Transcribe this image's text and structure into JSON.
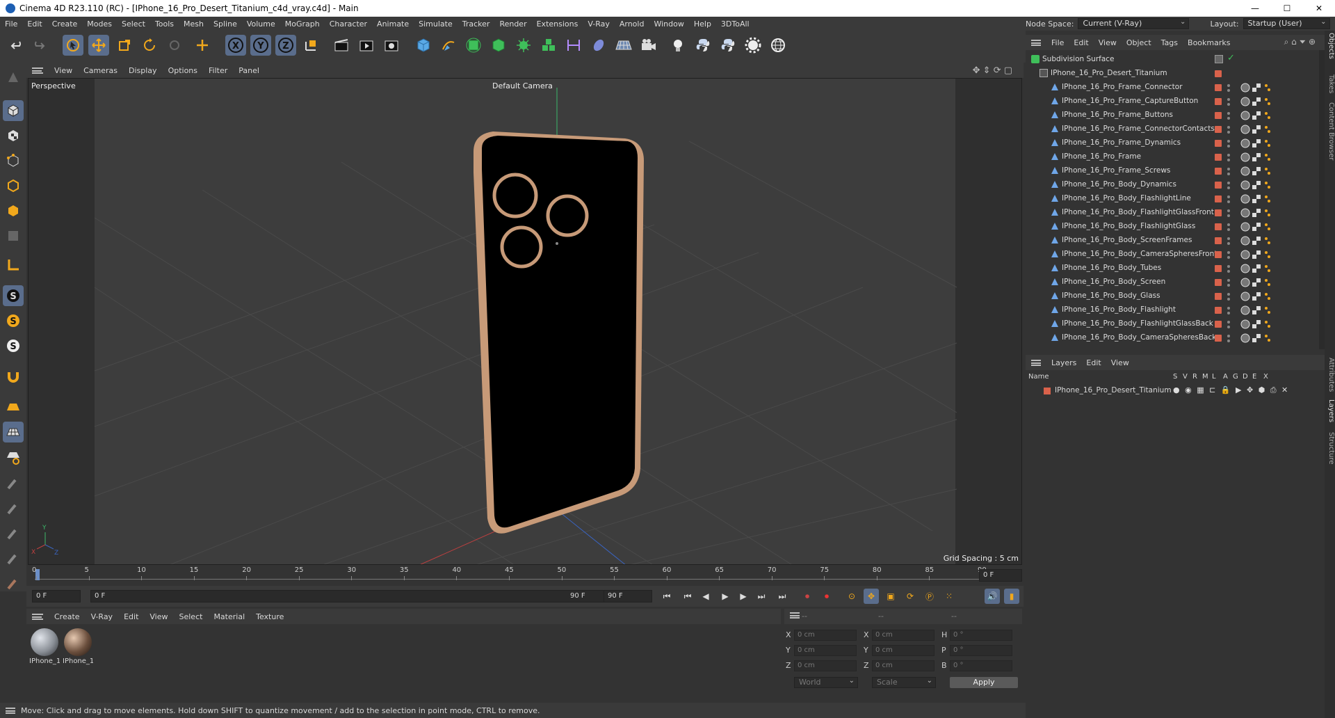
{
  "window": {
    "title": "Cinema 4D R23.110 (RC) - [IPhone_16_Pro_Desert_Titanium_c4d_vray.c4d] - Main",
    "minimize": "—",
    "maximize": "☐",
    "close": "✕"
  },
  "menubar": [
    "File",
    "Edit",
    "Create",
    "Modes",
    "Select",
    "Tools",
    "Mesh",
    "Spline",
    "Volume",
    "MoGraph",
    "Character",
    "Animate",
    "Simulate",
    "Tracker",
    "Render",
    "Extensions",
    "V-Ray",
    "Arnold",
    "Window",
    "Help",
    "3DToAll"
  ],
  "nodespace": {
    "label": "Node Space:",
    "value": "Current (V-Ray)",
    "layout_label": "Layout:",
    "layout_value": "Startup (User)"
  },
  "viewport": {
    "menu": [
      "View",
      "Cameras",
      "Display",
      "Options",
      "Filter",
      "Panel"
    ],
    "view_name": "Perspective",
    "camera_name": "Default Camera",
    "grid_spacing": "Grid Spacing : 5 cm"
  },
  "timeline": {
    "ticks": [
      "0",
      "5",
      "10",
      "15",
      "20",
      "25",
      "30",
      "35",
      "40",
      "45",
      "50",
      "55",
      "60",
      "65",
      "70",
      "75",
      "80",
      "85",
      "90"
    ],
    "end_frame_field": "0 F",
    "current_start": "0 F",
    "range_start": "0 F",
    "range_end": "90 F",
    "max_field": "90 F"
  },
  "materials": {
    "menu": [
      "Create",
      "V-Ray",
      "Edit",
      "View",
      "Select",
      "Material",
      "Texture"
    ],
    "items": [
      {
        "label": "IPhone_1",
        "color": "#8a8f96"
      },
      {
        "label": "IPhone_1",
        "color": "#6b4f3d"
      }
    ]
  },
  "coords": {
    "header": [
      "--",
      "--",
      "--"
    ],
    "rows": [
      {
        "l1": "X",
        "v1": "0 cm",
        "l2": "X",
        "v2": "0 cm",
        "l3": "H",
        "v3": "0 °"
      },
      {
        "l1": "Y",
        "v1": "0 cm",
        "l2": "Y",
        "v2": "0 cm",
        "l3": "P",
        "v3": "0 °"
      },
      {
        "l1": "Z",
        "v1": "0 cm",
        "l2": "Z",
        "v2": "0 cm",
        "l3": "B",
        "v3": "0 °"
      }
    ],
    "mode": "World",
    "scale": "Scale",
    "apply": "Apply"
  },
  "status": "Move: Click and drag to move elements. Hold down SHIFT to quantize movement / add to the selection in point mode, CTRL to remove.",
  "objects": {
    "menu": [
      "File",
      "Edit",
      "View",
      "Object",
      "Tags",
      "Bookmarks"
    ],
    "root": "Subdivision Surface",
    "group": "IPhone_16_Pro_Desert_Titanium",
    "items": [
      "IPhone_16_Pro_Frame_Connector",
      "IPhone_16_Pro_Frame_CaptureButton",
      "IPhone_16_Pro_Frame_Buttons",
      "IPhone_16_Pro_Frame_ConnectorContacts",
      "IPhone_16_Pro_Frame_Dynamics",
      "IPhone_16_Pro_Frame",
      "IPhone_16_Pro_Frame_Screws",
      "IPhone_16_Pro_Body_Dynamics",
      "IPhone_16_Pro_Body_FlashlightLine",
      "IPhone_16_Pro_Body_FlashlightGlassFront",
      "IPhone_16_Pro_Body_FlashlightGlass",
      "IPhone_16_Pro_Body_ScreenFrames",
      "IPhone_16_Pro_Body_CameraSpheresFront",
      "IPhone_16_Pro_Body_Tubes",
      "IPhone_16_Pro_Body_Screen",
      "IPhone_16_Pro_Body_Glass",
      "IPhone_16_Pro_Body_Flashlight",
      "IPhone_16_Pro_Body_FlashlightGlassBack",
      "IPhone_16_Pro_Body_CameraSpheresBack"
    ]
  },
  "layers": {
    "menu": [
      "Layers",
      "Edit",
      "View"
    ],
    "columns": [
      "Name",
      "S",
      "V",
      "R",
      "M",
      "L",
      "A",
      "G",
      "D",
      "E",
      "X"
    ],
    "row": "IPhone_16_Pro_Desert_Titanium"
  },
  "sidetabs": [
    "Objects",
    "Takes",
    "Content Browser",
    "Attributes",
    "Layers",
    "Structure"
  ],
  "colors": {
    "accent": "#5a6d8c",
    "swatch": "#d9624b",
    "bronze": "#c79a78"
  }
}
